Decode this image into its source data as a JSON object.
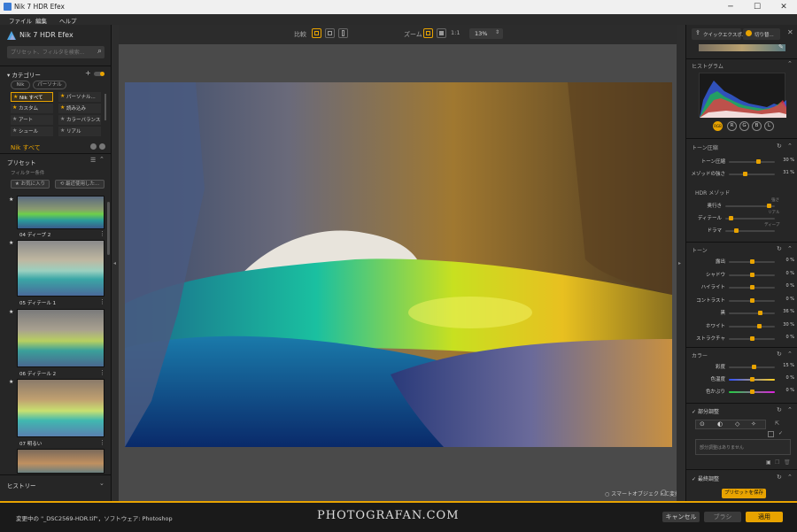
{
  "window": {
    "title": "Nik 7 HDR Efex",
    "min": "─",
    "max": "☐",
    "close": "✕"
  },
  "menu": [
    "ファイル",
    "編集",
    "ヘルプ"
  ],
  "left": {
    "app_title": "Nik 7 HDR Efex",
    "search_placeholder": "プリセット、フィルタを検索...",
    "category_label": "カテゴリー",
    "pills": [
      "Nik",
      "パーソナル"
    ],
    "categories": [
      [
        "Nik すべて",
        "パーソナル..."
      ],
      [
        "カスタム",
        "読み込み"
      ],
      [
        "アート",
        "カラーバランス"
      ],
      [
        "シュール",
        "リアル"
      ]
    ],
    "current": "Nik すべて",
    "preset_label": "プリセット",
    "filter_label": "フィルター条件",
    "fav_btn": "お気に入り",
    "recent_btn": "最近使用した...",
    "thumbs": [
      "04 ディープ 2",
      "05 ディテール 1",
      "06 ディテール 2",
      "07 明るい"
    ],
    "history": "ヒストリー"
  },
  "top": {
    "compare": "比較",
    "zoom": "ズーム",
    "ratio": "1:1",
    "zoom_value": "13%"
  },
  "right": {
    "quick_export": "クイックエクスポ...",
    "switch": "切り替...",
    "histogram": "ヒストグラム",
    "channels": [
      "RGB",
      "R",
      "G",
      "B",
      "L"
    ],
    "tone_comp": "トーン圧縮",
    "tone_sliders": [
      {
        "label": "トーン圧縮",
        "value": "30 %",
        "level": 0.65
      },
      {
        "label": "メゾッドの強さ",
        "value": "31 %",
        "level": 0.35
      }
    ],
    "hdr_method": "HDR メゾッド",
    "hdr_sliders": [
      {
        "label": "奥行き",
        "level": 0.92
      },
      {
        "label": "ディテール",
        "level": 0.08
      },
      {
        "label": "ドラマ",
        "level": 0.2
      }
    ],
    "hdr_labels": {
      "strong": "強さ",
      "real": "リアル",
      "deep": "ディープ"
    },
    "tone": "トーン",
    "tone_list": [
      {
        "label": "露出",
        "value": "0 %",
        "level": 0.5
      },
      {
        "label": "シャドウ",
        "value": "0 %",
        "level": 0.5
      },
      {
        "label": "ハイライト",
        "value": "0 %",
        "level": 0.5
      },
      {
        "label": "コントラスト",
        "value": "0 %",
        "level": 0.5
      },
      {
        "label": "黒",
        "value": "36 %",
        "level": 0.7
      },
      {
        "label": "ホワイト",
        "value": "30 %",
        "level": 0.68
      },
      {
        "label": "ストラクチャ",
        "value": "0 %",
        "level": 0.5
      }
    ],
    "color": "カラー",
    "color_list": [
      {
        "label": "彩度",
        "value": "15 %",
        "level": 0.56
      },
      {
        "label": "色温度",
        "value": "0 %",
        "level": 0.5
      },
      {
        "label": "色かぶり",
        "value": "0 %",
        "level": 0.5
      }
    ],
    "local": "部分調整",
    "local_empty": "部分調整はありません",
    "final": "最終調整",
    "save_preset": "プリセットを保存"
  },
  "smart_object": "スマートオブジェクトに変換",
  "bottom": {
    "status": "変更中の \"_DSC2569-HDR.tif\"，ソフトウェア: Photoshop",
    "watermark": "PHOTOGRAFAN.COM",
    "cancel": "キャンセル",
    "brush": "ブラシ",
    "apply": "適用"
  },
  "colors": {
    "accent": "#e8a300"
  }
}
